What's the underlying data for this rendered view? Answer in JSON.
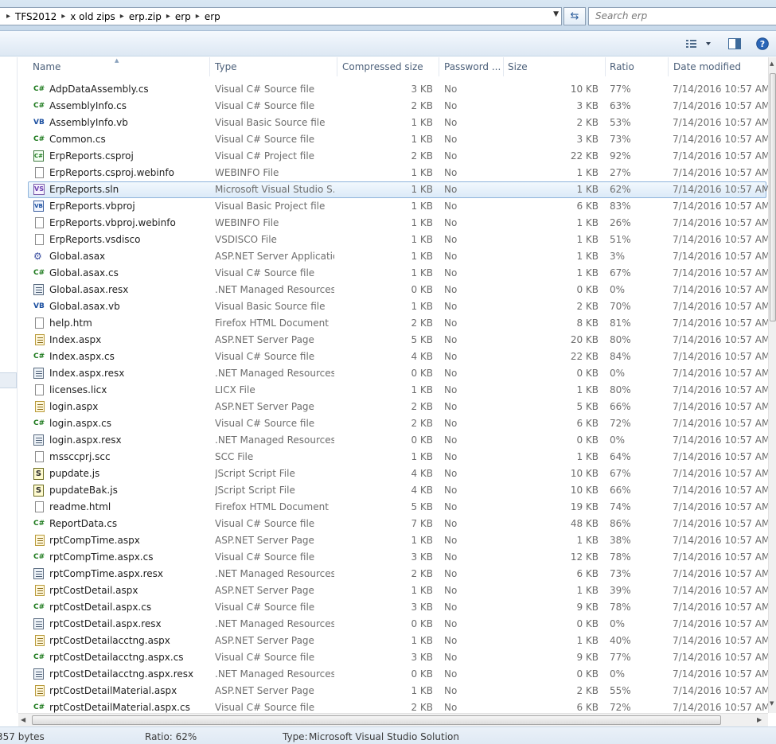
{
  "address": {
    "crumbs": [
      "TFS2012",
      "x old zips",
      "erp.zip",
      "erp",
      "erp"
    ],
    "search_placeholder": "Search erp"
  },
  "columns": {
    "name": "Name",
    "type": "Type",
    "compressed": "Compressed size",
    "password": "Password ...",
    "size": "Size",
    "ratio": "Ratio",
    "date": "Date modified"
  },
  "rows": [
    {
      "name": "AdpDataAssembly.cs",
      "icon": "cs-file-icon",
      "type": "Visual C# Source file",
      "compressed": "3 KB",
      "password": "No",
      "size": "10 KB",
      "ratio": "77%",
      "date": "7/14/2016 10:57 AM"
    },
    {
      "name": "AssemblyInfo.cs",
      "icon": "cs-file-icon",
      "type": "Visual C# Source file",
      "compressed": "2 KB",
      "password": "No",
      "size": "3 KB",
      "ratio": "63%",
      "date": "7/14/2016 10:57 AM"
    },
    {
      "name": "AssemblyInfo.vb",
      "icon": "vb-file-icon",
      "type": "Visual Basic Source file",
      "compressed": "1 KB",
      "password": "No",
      "size": "2 KB",
      "ratio": "53%",
      "date": "7/14/2016 10:57 AM"
    },
    {
      "name": "Common.cs",
      "icon": "cs-file-icon",
      "type": "Visual C# Source file",
      "compressed": "1 KB",
      "password": "No",
      "size": "3 KB",
      "ratio": "73%",
      "date": "7/14/2016 10:57 AM"
    },
    {
      "name": "ErpReports.csproj",
      "icon": "csproj-file-icon",
      "type": "Visual C# Project file",
      "compressed": "2 KB",
      "password": "No",
      "size": "22 KB",
      "ratio": "92%",
      "date": "7/14/2016 10:57 AM"
    },
    {
      "name": "ErpReports.csproj.webinfo",
      "icon": "document-icon",
      "type": "WEBINFO File",
      "compressed": "1 KB",
      "password": "No",
      "size": "1 KB",
      "ratio": "27%",
      "date": "7/14/2016 10:57 AM"
    },
    {
      "name": "ErpReports.sln",
      "icon": "sln-file-icon",
      "type": "Microsoft Visual Studio S...",
      "compressed": "1 KB",
      "password": "No",
      "size": "1 KB",
      "ratio": "62%",
      "date": "7/14/2016 10:57 AM",
      "selected": true
    },
    {
      "name": "ErpReports.vbproj",
      "icon": "vbproj-file-icon",
      "type": "Visual Basic Project file",
      "compressed": "1 KB",
      "password": "No",
      "size": "6 KB",
      "ratio": "83%",
      "date": "7/14/2016 10:57 AM"
    },
    {
      "name": "ErpReports.vbproj.webinfo",
      "icon": "document-icon",
      "type": "WEBINFO File",
      "compressed": "1 KB",
      "password": "No",
      "size": "1 KB",
      "ratio": "26%",
      "date": "7/14/2016 10:57 AM"
    },
    {
      "name": "ErpReports.vsdisco",
      "icon": "document-icon",
      "type": "VSDISCO File",
      "compressed": "1 KB",
      "password": "No",
      "size": "1 KB",
      "ratio": "51%",
      "date": "7/14/2016 10:57 AM"
    },
    {
      "name": "Global.asax",
      "icon": "asax-file-icon",
      "type": "ASP.NET Server Application",
      "compressed": "1 KB",
      "password": "No",
      "size": "1 KB",
      "ratio": "3%",
      "date": "7/14/2016 10:57 AM"
    },
    {
      "name": "Global.asax.cs",
      "icon": "cs-file-icon",
      "type": "Visual C# Source file",
      "compressed": "1 KB",
      "password": "No",
      "size": "1 KB",
      "ratio": "67%",
      "date": "7/14/2016 10:57 AM"
    },
    {
      "name": "Global.asax.resx",
      "icon": "resx-file-icon",
      "type": ".NET Managed Resources ...",
      "compressed": "0 KB",
      "password": "No",
      "size": "0 KB",
      "ratio": "0%",
      "date": "7/14/2016 10:57 AM"
    },
    {
      "name": "Global.asax.vb",
      "icon": "vb-file-icon",
      "type": "Visual Basic Source file",
      "compressed": "1 KB",
      "password": "No",
      "size": "2 KB",
      "ratio": "70%",
      "date": "7/14/2016 10:57 AM"
    },
    {
      "name": "help.htm",
      "icon": "document-icon",
      "type": "Firefox HTML Document",
      "compressed": "2 KB",
      "password": "No",
      "size": "8 KB",
      "ratio": "81%",
      "date": "7/14/2016 10:57 AM"
    },
    {
      "name": "Index.aspx",
      "icon": "aspx-file-icon",
      "type": "ASP.NET Server Page",
      "compressed": "5 KB",
      "password": "No",
      "size": "20 KB",
      "ratio": "80%",
      "date": "7/14/2016 10:57 AM"
    },
    {
      "name": "Index.aspx.cs",
      "icon": "cs-file-icon",
      "type": "Visual C# Source file",
      "compressed": "4 KB",
      "password": "No",
      "size": "22 KB",
      "ratio": "84%",
      "date": "7/14/2016 10:57 AM"
    },
    {
      "name": "Index.aspx.resx",
      "icon": "resx-file-icon",
      "type": ".NET Managed Resources ...",
      "compressed": "0 KB",
      "password": "No",
      "size": "0 KB",
      "ratio": "0%",
      "date": "7/14/2016 10:57 AM"
    },
    {
      "name": "licenses.licx",
      "icon": "document-icon",
      "type": "LICX File",
      "compressed": "1 KB",
      "password": "No",
      "size": "1 KB",
      "ratio": "80%",
      "date": "7/14/2016 10:57 AM"
    },
    {
      "name": "login.aspx",
      "icon": "aspx-file-icon",
      "type": "ASP.NET Server Page",
      "compressed": "2 KB",
      "password": "No",
      "size": "5 KB",
      "ratio": "66%",
      "date": "7/14/2016 10:57 AM"
    },
    {
      "name": "login.aspx.cs",
      "icon": "cs-file-icon",
      "type": "Visual C# Source file",
      "compressed": "2 KB",
      "password": "No",
      "size": "6 KB",
      "ratio": "72%",
      "date": "7/14/2016 10:57 AM"
    },
    {
      "name": "login.aspx.resx",
      "icon": "resx-file-icon",
      "type": ".NET Managed Resources ...",
      "compressed": "0 KB",
      "password": "No",
      "size": "0 KB",
      "ratio": "0%",
      "date": "7/14/2016 10:57 AM"
    },
    {
      "name": "mssccprj.scc",
      "icon": "document-icon",
      "type": "SCC File",
      "compressed": "1 KB",
      "password": "No",
      "size": "1 KB",
      "ratio": "64%",
      "date": "7/14/2016 10:57 AM"
    },
    {
      "name": "pupdate.js",
      "icon": "js-file-icon",
      "type": "JScript Script File",
      "compressed": "4 KB",
      "password": "No",
      "size": "10 KB",
      "ratio": "67%",
      "date": "7/14/2016 10:57 AM"
    },
    {
      "name": "pupdateBak.js",
      "icon": "js-file-icon",
      "type": "JScript Script File",
      "compressed": "4 KB",
      "password": "No",
      "size": "10 KB",
      "ratio": "66%",
      "date": "7/14/2016 10:57 AM"
    },
    {
      "name": "readme.html",
      "icon": "document-icon",
      "type": "Firefox HTML Document",
      "compressed": "5 KB",
      "password": "No",
      "size": "19 KB",
      "ratio": "74%",
      "date": "7/14/2016 10:57 AM"
    },
    {
      "name": "ReportData.cs",
      "icon": "cs-file-icon",
      "type": "Visual C# Source file",
      "compressed": "7 KB",
      "password": "No",
      "size": "48 KB",
      "ratio": "86%",
      "date": "7/14/2016 10:57 AM"
    },
    {
      "name": "rptCompTime.aspx",
      "icon": "aspx-file-icon",
      "type": "ASP.NET Server Page",
      "compressed": "1 KB",
      "password": "No",
      "size": "1 KB",
      "ratio": "38%",
      "date": "7/14/2016 10:57 AM"
    },
    {
      "name": "rptCompTime.aspx.cs",
      "icon": "cs-file-icon",
      "type": "Visual C# Source file",
      "compressed": "3 KB",
      "password": "No",
      "size": "12 KB",
      "ratio": "78%",
      "date": "7/14/2016 10:57 AM"
    },
    {
      "name": "rptCompTime.aspx.resx",
      "icon": "resx-file-icon",
      "type": ".NET Managed Resources ...",
      "compressed": "2 KB",
      "password": "No",
      "size": "6 KB",
      "ratio": "73%",
      "date": "7/14/2016 10:57 AM"
    },
    {
      "name": "rptCostDetail.aspx",
      "icon": "aspx-file-icon",
      "type": "ASP.NET Server Page",
      "compressed": "1 KB",
      "password": "No",
      "size": "1 KB",
      "ratio": "39%",
      "date": "7/14/2016 10:57 AM"
    },
    {
      "name": "rptCostDetail.aspx.cs",
      "icon": "cs-file-icon",
      "type": "Visual C# Source file",
      "compressed": "3 KB",
      "password": "No",
      "size": "9 KB",
      "ratio": "78%",
      "date": "7/14/2016 10:57 AM"
    },
    {
      "name": "rptCostDetail.aspx.resx",
      "icon": "resx-file-icon",
      "type": ".NET Managed Resources ...",
      "compressed": "0 KB",
      "password": "No",
      "size": "0 KB",
      "ratio": "0%",
      "date": "7/14/2016 10:57 AM"
    },
    {
      "name": "rptCostDetailacctng.aspx",
      "icon": "aspx-file-icon",
      "type": "ASP.NET Server Page",
      "compressed": "1 KB",
      "password": "No",
      "size": "1 KB",
      "ratio": "40%",
      "date": "7/14/2016 10:57 AM"
    },
    {
      "name": "rptCostDetailacctng.aspx.cs",
      "icon": "cs-file-icon",
      "type": "Visual C# Source file",
      "compressed": "3 KB",
      "password": "No",
      "size": "9 KB",
      "ratio": "77%",
      "date": "7/14/2016 10:57 AM"
    },
    {
      "name": "rptCostDetailacctng.aspx.resx",
      "icon": "resx-file-icon",
      "type": ".NET Managed Resources ...",
      "compressed": "0 KB",
      "password": "No",
      "size": "0 KB",
      "ratio": "0%",
      "date": "7/14/2016 10:57 AM"
    },
    {
      "name": "rptCostDetailMaterial.aspx",
      "icon": "aspx-file-icon",
      "type": "ASP.NET Server Page",
      "compressed": "1 KB",
      "password": "No",
      "size": "2 KB",
      "ratio": "55%",
      "date": "7/14/2016 10:57 AM"
    },
    {
      "name": "rptCostDetailMaterial.aspx.cs",
      "icon": "cs-file-icon",
      "type": "Visual C# Source file",
      "compressed": "2 KB",
      "password": "No",
      "size": "6 KB",
      "ratio": "72%",
      "date": "7/14/2016 10:57 AM"
    }
  ],
  "status": {
    "bytes": "357 bytes",
    "ratio": "Ratio: 62%",
    "type_label": "Type:",
    "type_value": "Microsoft Visual Studio Solution"
  }
}
